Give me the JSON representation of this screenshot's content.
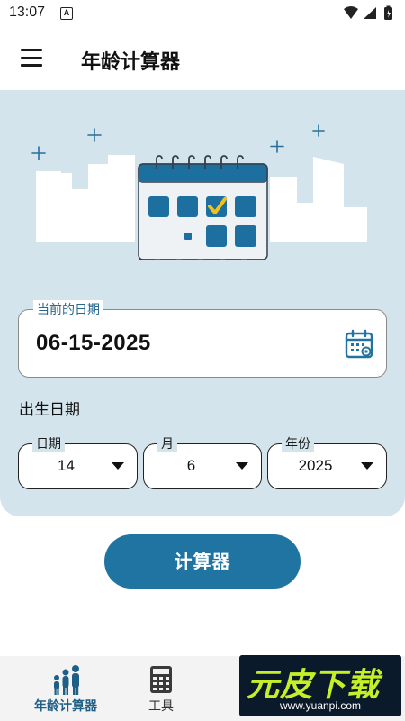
{
  "status_bar": {
    "time": "13:07",
    "notif_glyph": "A",
    "icons": [
      "wifi-icon",
      "signal-icon",
      "battery-icon"
    ]
  },
  "app_bar": {
    "title": "年龄计算器",
    "menu_icon": "menu-icon"
  },
  "current_date": {
    "label": "当前的日期",
    "value": "06-15-2025",
    "icon": "calendar-icon"
  },
  "birth": {
    "label": "出生日期",
    "day": {
      "label": "日期",
      "value": "14"
    },
    "month": {
      "label": "月",
      "value": "6"
    },
    "year": {
      "label": "年份",
      "value": "2025"
    }
  },
  "calculate_button": {
    "label": "计算器"
  },
  "bottom_nav": {
    "items": [
      {
        "label": "年龄计算器",
        "icon": "family-icon",
        "active": true
      },
      {
        "label": "工具",
        "icon": "calculator-icon",
        "active": false
      }
    ]
  },
  "watermark": {
    "logo": "元皮下载",
    "url": "www.yuanpi.com"
  },
  "colors": {
    "accent": "#1f74a1",
    "hero_bg": "#d3e4ec",
    "nav_bg": "#f3f3f3"
  }
}
